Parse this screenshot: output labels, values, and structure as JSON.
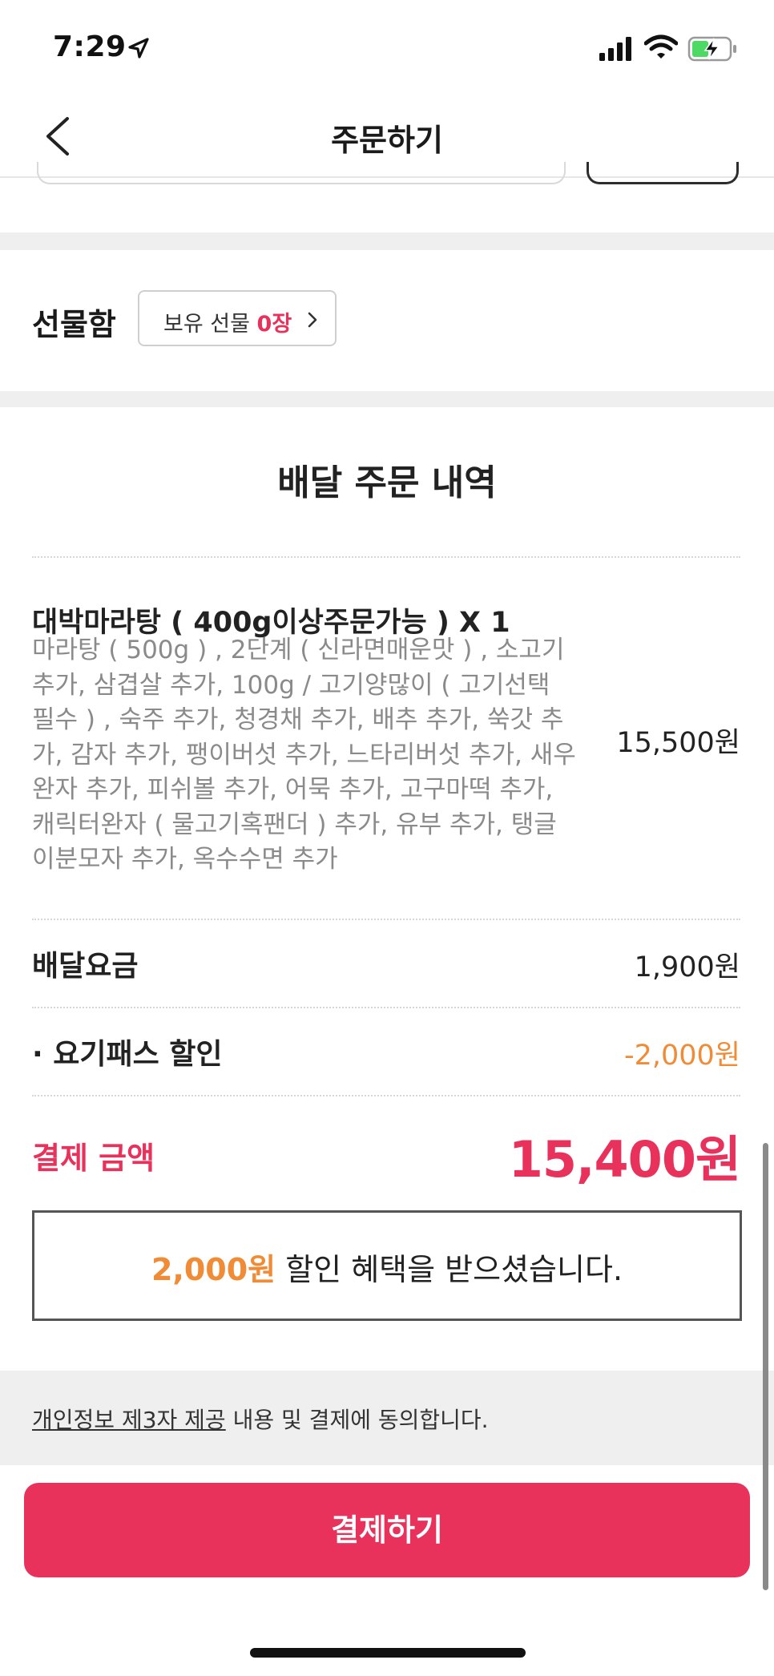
{
  "status_bar": {
    "time": "7:29",
    "icons": [
      "location-arrow-icon",
      "cellular-signal-icon",
      "wifi-icon",
      "battery-charging-icon"
    ]
  },
  "header": {
    "title": "주문하기",
    "back_icon": "chevron-left-icon"
  },
  "gift": {
    "label": "선물함",
    "button_prefix": "보유 선물 ",
    "button_count": "0장",
    "chevron_icon": "chevron-right-icon"
  },
  "order": {
    "title": "배달 주문 내역",
    "item": {
      "name": "대박마라탕 ( 400g이상주문가능 )  X 1",
      "options": "마라탕 ( 500g ) , 2단계 ( 신라면매운맛 ) , 소고기 추가, 삼겹살 추가, 100g / 고기양많이 ( 고기선택 필수 ) , 숙주 추가, 청경채 추가, 배추 추가, 쑥갓 추가, 감자 추가, 팽이버섯 추가, 느타리버섯 추가, 새우완자 추가, 피쉬볼 추가, 어묵 추가, 고구마떡 추가, 캐릭터완자 ( 물고기혹팬더 ) 추가, 유부 추가, 탱글이분모자 추가, 옥수수면 추가",
      "price": "15,500원"
    },
    "delivery_fee": {
      "label": "배달요금",
      "value": "1,900원"
    },
    "discount": {
      "label": "· 요기패스 할인",
      "value": "-2,000원"
    },
    "total": {
      "label": "결제 금액",
      "value": "15,400원"
    },
    "discount_notice": {
      "amount": "2,000원",
      "text": " 할인 혜택을 받으셨습니다."
    }
  },
  "agreement": {
    "link": "개인정보 제3자 제공",
    "text": " 내용 및 결제에 동의합니다."
  },
  "pay_button": {
    "label": "결제하기"
  },
  "colors": {
    "accent": "#e8315b",
    "discount": "#f08b36",
    "band": "#efefef"
  }
}
